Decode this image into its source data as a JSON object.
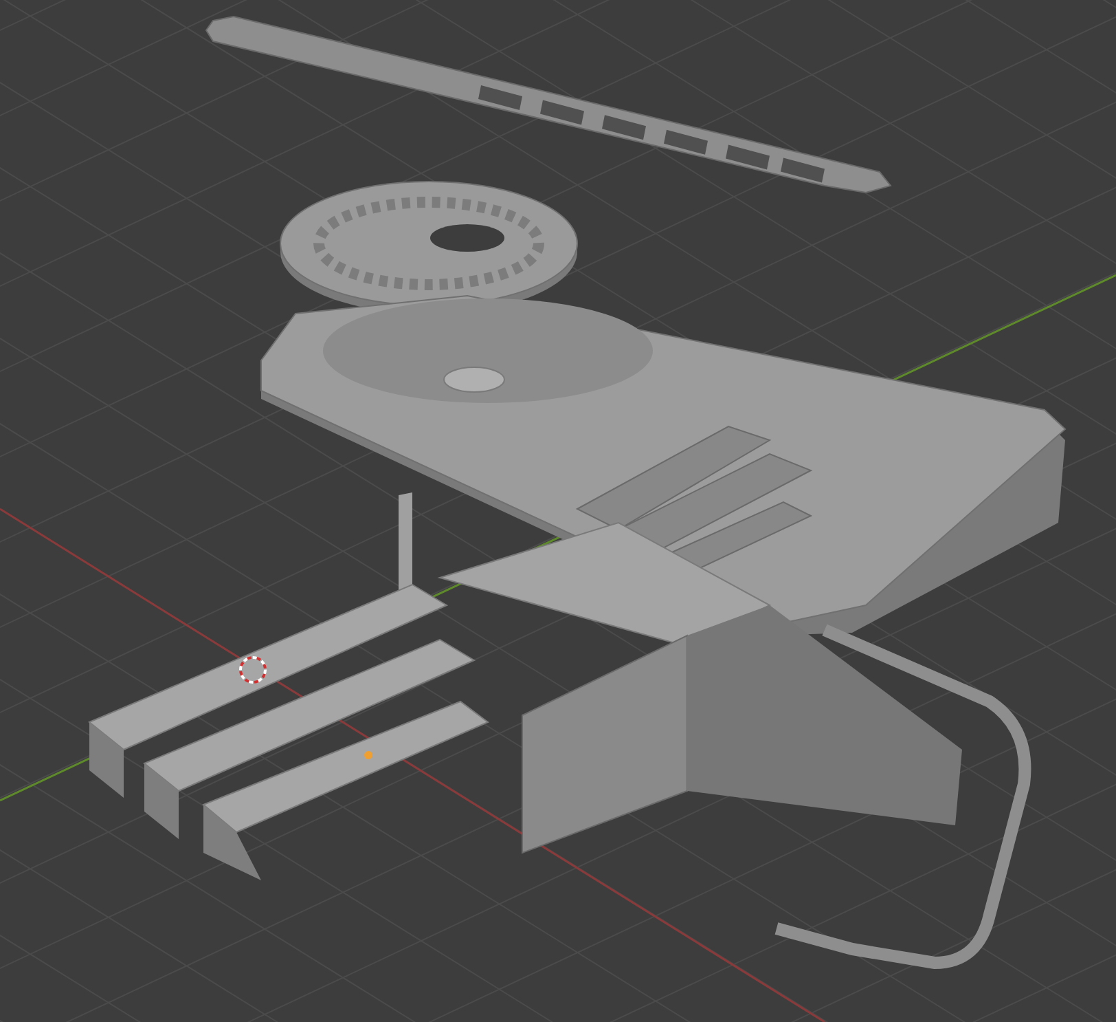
{
  "viewport": {
    "show_grid": true,
    "show_axes": true,
    "selected_origin": true
  }
}
